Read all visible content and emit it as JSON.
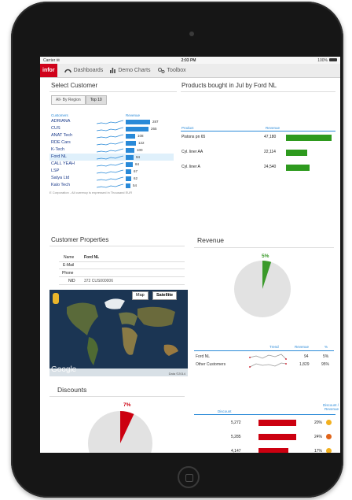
{
  "status": {
    "carrier": "Carrier ✉",
    "time": "2:03 PM",
    "battery": "100%"
  },
  "nav": {
    "logo": "infor",
    "items": [
      {
        "label": "Dashboards",
        "icon": "dashboard-gauge-icon"
      },
      {
        "label": "Demo Charts",
        "icon": "bar-chart-icon"
      },
      {
        "label": "Toolbox",
        "icon": "gears-icon"
      }
    ]
  },
  "select_customer": {
    "title": "Select Customer",
    "segments": [
      "All- By Region",
      "Top 10"
    ],
    "active_segment": 1,
    "col_customers": "Customers",
    "col_revenue": "Revenue",
    "selected_index": 5,
    "rows": [
      {
        "name": "ADRIANA",
        "value": "287",
        "v": 287
      },
      {
        "name": "CUS",
        "value": "265",
        "v": 265
      },
      {
        "name": "ANAT Tech",
        "value": "108",
        "v": 108
      },
      {
        "name": "RDE Cars",
        "value": "122",
        "v": 122
      },
      {
        "name": "K-Tech",
        "value": "100",
        "v": 100
      },
      {
        "name": "Ford NL",
        "value": "94",
        "v": 94
      },
      {
        "name": "CALL YEAH",
        "value": "84",
        "v": 84
      },
      {
        "name": "LSP",
        "value": "67",
        "v": 67
      },
      {
        "name": "Satya Ltd",
        "value": "62",
        "v": 62
      },
      {
        "name": "Kalo Tech",
        "value": "54",
        "v": 54
      }
    ],
    "footnote": "E Corporation - All currency is expressed in Thousand EUR"
  },
  "products": {
    "title": "Products bought in Jul by Ford NL",
    "col_product": "Product",
    "col_revenue": "Revenue",
    "rows": [
      {
        "name": "Pistons pn 65",
        "value": "47,180",
        "v": 47180
      },
      {
        "name": "Cyl. liner AA",
        "value": "22,114",
        "v": 22114
      },
      {
        "name": "Cyl. liner A",
        "value": "24,540",
        "v": 24540
      }
    ]
  },
  "customer_properties": {
    "title": "Customer Properties",
    "fields": [
      {
        "label": "Name",
        "value": "Ford NL"
      },
      {
        "label": "E-Mail",
        "value": ""
      },
      {
        "label": "Phone",
        "value": ""
      },
      {
        "label": "NID",
        "value": "372 CUS000006"
      }
    ],
    "map": {
      "btn_map": "Map",
      "btn_satellite": "Satellite",
      "brand": "Google",
      "data_note": "Data ©2014"
    }
  },
  "revenue": {
    "title": "Revenue",
    "slice_label": "5%",
    "slice_percent": 5,
    "col_trend": "Trend",
    "col_revenue": "Revenue",
    "col_pct": "%",
    "rows": [
      {
        "name": "Ford NL",
        "value": "94",
        "pct": "5%"
      },
      {
        "name": "Other Customers",
        "value": "1,829",
        "pct": "95%"
      }
    ]
  },
  "discounts": {
    "title": "Discounts",
    "slice_label": "7%",
    "slice_percent": 7,
    "col_discount": "Discount",
    "col_ratio": "Discount / Revenue",
    "rows": [
      {
        "value": "5,272",
        "v": 5272,
        "pct": "20%",
        "dot": "#f2b01e"
      },
      {
        "value": "5,285",
        "v": 5285,
        "pct": "24%",
        "dot": "#e0641a"
      },
      {
        "value": "4,147",
        "v": 4147,
        "pct": "17%",
        "dot": "#f2b01e"
      }
    ]
  },
  "colors": {
    "brand": "#d0021b",
    "customer_bar": "#2a8ad8",
    "product_bar": "#2e9a1e",
    "revenue_slice": "#3a9a2a",
    "discount_slice": "#cc0010"
  }
}
